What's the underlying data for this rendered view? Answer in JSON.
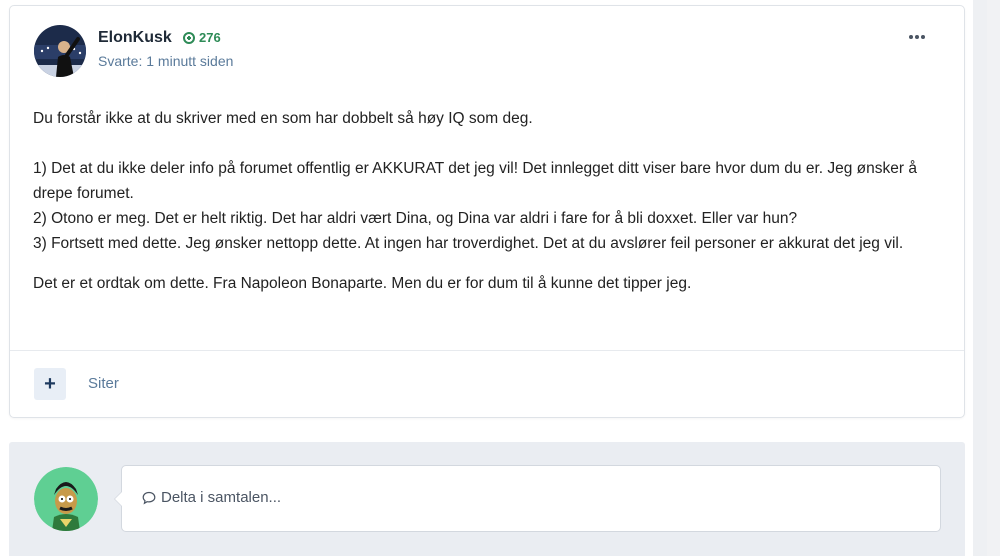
{
  "post": {
    "author": "ElonKusk",
    "reputation": "276",
    "meta": "Svarte: 1 minutt siden",
    "paragraphs": [
      "Du forstår ikke at du skriver med en som har dobbelt så høy IQ som deg.",
      "1) Det at du ikke deler info på forumet offentlig er AKKURAT det jeg vil! Det innlegget ditt viser bare hvor dum du er. Jeg ønsker å drepe forumet.",
      "2) Otono er meg. Det er helt riktig. Det har aldri vært Dina, og Dina var aldri i fare for å bli doxxet. Eller var hun?",
      "3) Fortsett med dette. Jeg ønsker nettopp dette. At ingen har troverdighet. Det at du avslører feil personer er akkurat det jeg vil.",
      "Det er et ordtak om dette. Fra Napoleon Bonaparte. Men du er for dum til å kunne det tipper jeg."
    ],
    "quote_label": "Siter",
    "more_icon": "ellipsis-icon",
    "rep_icon": "plus-circle-icon"
  },
  "reply": {
    "placeholder": "Delta i samtalen...",
    "icon": "speech-bubble-icon"
  },
  "colors": {
    "accent": "#2e8b57",
    "meta": "#5a7a9a",
    "reply_bg": "#eaedf2"
  }
}
